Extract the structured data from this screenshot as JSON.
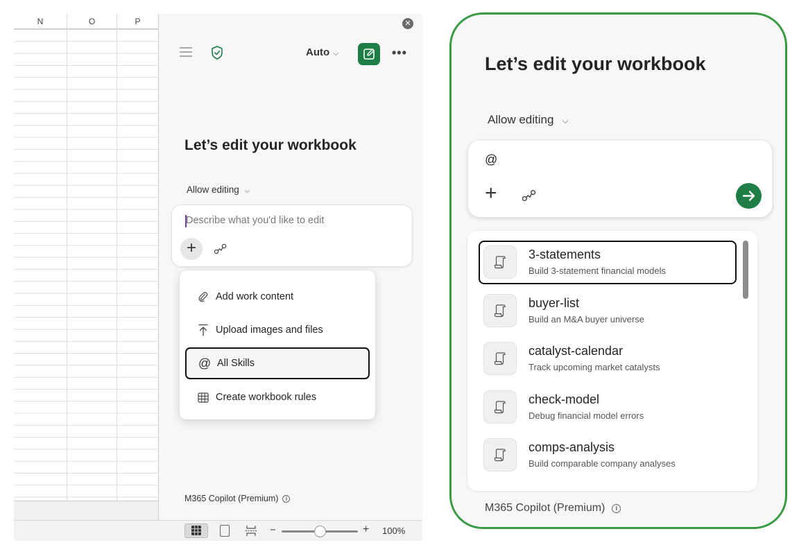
{
  "sheet": {
    "columns": [
      "N",
      "O",
      "P"
    ]
  },
  "copilot": {
    "close_label": "✕",
    "mode_label": "Auto",
    "more_label": "•••",
    "heading": "Let’s edit your workbook",
    "allow_editing": "Allow editing",
    "input_placeholder": "Describe what you'd like to edit",
    "plus_label": "+",
    "menu": [
      {
        "label": "Add work content",
        "icon": "paperclip-icon"
      },
      {
        "label": "Upload images and files",
        "icon": "upload-icon"
      },
      {
        "label": "All Skills",
        "icon": "at-icon",
        "selected": true
      },
      {
        "label": "Create workbook rules",
        "icon": "table-icon"
      }
    ],
    "footer": "M365 Copilot (Premium)",
    "info_label": "i"
  },
  "statusbar": {
    "zoom_minus": "−",
    "zoom_plus": "+",
    "zoom_level": "100%",
    "zoom_fraction": 0.5
  },
  "zoomed": {
    "heading": "Let’s edit your workbook",
    "allow_editing": "Allow editing",
    "input_value": "@",
    "plus_label": "+",
    "skills": [
      {
        "name": "3-statements",
        "desc": "Build 3-statement financial models",
        "selected": true
      },
      {
        "name": "buyer-list",
        "desc": "Build an M&A buyer universe"
      },
      {
        "name": "catalyst-calendar",
        "desc": "Track upcoming market catalysts"
      },
      {
        "name": "check-model",
        "desc": "Debug financial model errors"
      },
      {
        "name": "comps-analysis",
        "desc": "Build comparable company analyses"
      }
    ],
    "footer": "M365 Copilot (Premium)",
    "info_label": "i"
  },
  "colors": {
    "accent_green": "#1e7e45",
    "highlight_border": "#3a9a43"
  }
}
